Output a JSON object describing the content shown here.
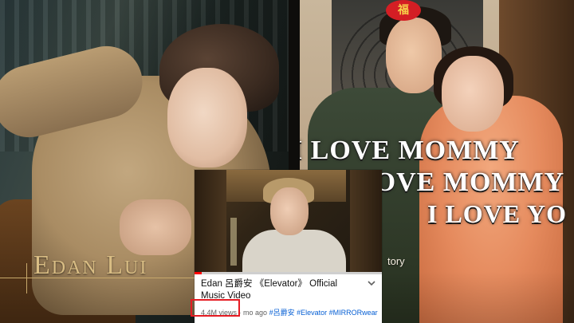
{
  "left_panel": {
    "artist_name": "Edan Lui"
  },
  "right_panel": {
    "lantern_glyph": "福",
    "lyrics": [
      "I LOVE MOMMY",
      "LOVE MOMMY",
      "I LOVE YO"
    ],
    "caption_fragment": "tory"
  },
  "video_card": {
    "title": "Edan 呂爵安 《Elevator》 Official Music Video",
    "more_icon": "chevron-down-icon",
    "views": "4.4M views",
    "age_fragment": "· mo ago",
    "hashtags": [
      "#呂爵安",
      "#Elevator",
      "#MIRRORwear"
    ],
    "progress_fraction": 0.04
  },
  "colors": {
    "highlight_box": "#e51c23",
    "hashtag": "#065fd4",
    "progress": "#ff0000",
    "name_gold": "#d9bd84"
  }
}
